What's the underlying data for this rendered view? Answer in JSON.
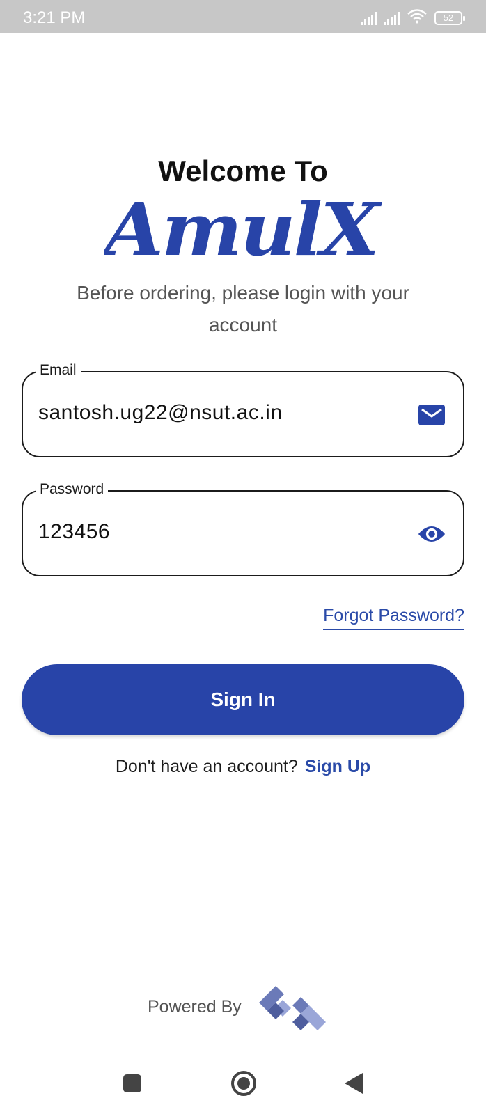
{
  "status_bar": {
    "time": "3:21 PM",
    "battery": "52"
  },
  "header": {
    "welcome": "Welcome To",
    "brand": "AmulX",
    "subtitle": "Before ordering, please login with your account"
  },
  "form": {
    "email": {
      "label": "Email",
      "value": "santosh.ug22@nsut.ac.in",
      "icon": "mail-icon"
    },
    "password": {
      "label": "Password",
      "value": "123456",
      "icon": "eye-icon"
    },
    "forgot_label": "Forgot Password?",
    "signin_label": "Sign In",
    "no_account_text": "Don't have an account?",
    "signup_label": "Sign Up"
  },
  "footer": {
    "powered_by": "Powered By"
  },
  "colors": {
    "primary": "#2844a8",
    "link": "#2a4aa8",
    "status_bar": "#c7c7c7"
  }
}
